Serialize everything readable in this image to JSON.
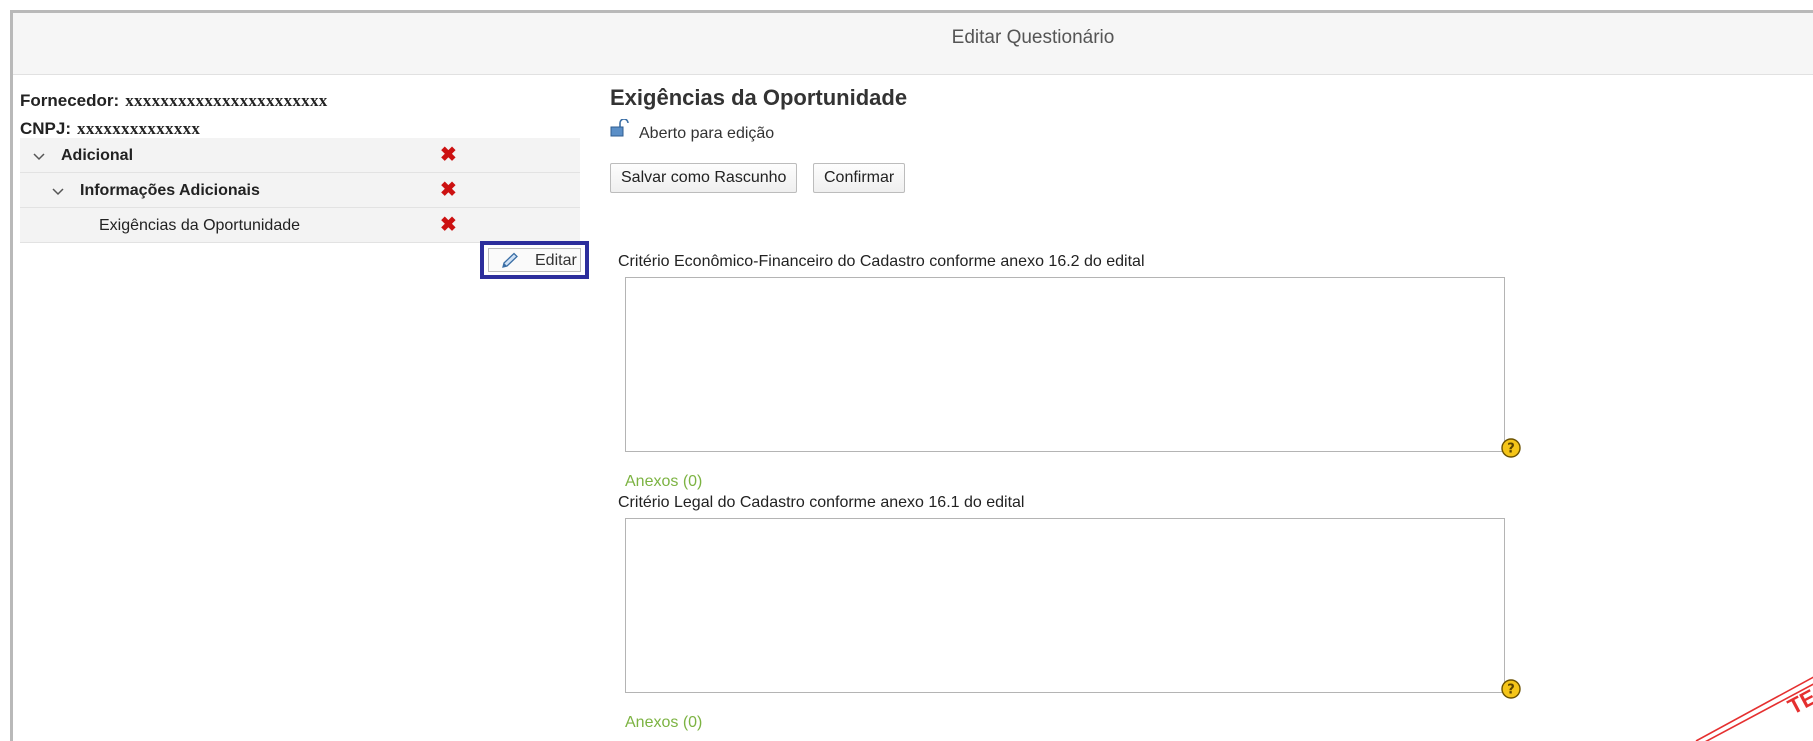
{
  "window": {
    "title": "Editar Questionário"
  },
  "supplier": {
    "fornecedor_label": "Fornecedor:",
    "fornecedor_value": "xxxxxxxxxxxxxxxxxxxxxxx",
    "cnpj_label": "CNPJ:",
    "cnpj_value": "xxxxxxxxxxxxxx"
  },
  "tree": {
    "items": [
      {
        "label": "Adicional",
        "level": 0,
        "expanded": true
      },
      {
        "label": "Informações Adicionais",
        "level": 1,
        "expanded": true
      },
      {
        "label": "Exigências da Oportunidade",
        "level": 2
      }
    ],
    "edit_label": "Editar"
  },
  "section": {
    "title": "Exigências da Oportunidade",
    "status": "Aberto para edição"
  },
  "toolbar": {
    "save_draft_label": "Salvar como Rascunho",
    "confirm_label": "Confirmar"
  },
  "questions": [
    {
      "label": "Critério Econômico-Financeiro do Cadastro conforme anexo 16.2 do edital",
      "value": "",
      "attachments": "Anexos (0)"
    },
    {
      "label": "Critério Legal do Cadastro conforme anexo 16.1 do edital",
      "value": "",
      "attachments": "Anexos (0)"
    }
  ],
  "colors": {
    "accent_border": "#2c2e9c",
    "delete_icon": "#cc1111",
    "attachments_link": "#7cb342",
    "help_icon": "#f5c518"
  },
  "stamp_text": "TE"
}
